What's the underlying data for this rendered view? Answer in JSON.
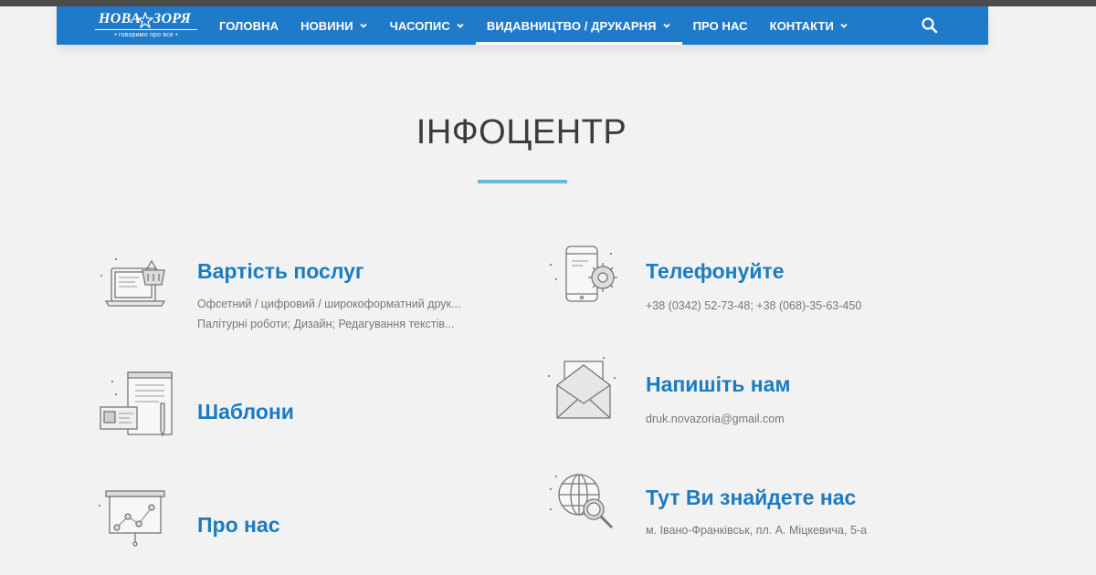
{
  "logo": {
    "word1": "НОВА",
    "word2": "ЗОРЯ",
    "slogan": "• говоримо про все •"
  },
  "nav": {
    "items": [
      {
        "label": "ГОЛОВНА",
        "has_dropdown": false
      },
      {
        "label": "НОВИНИ",
        "has_dropdown": true
      },
      {
        "label": "ЧАСОПИС",
        "has_dropdown": true
      },
      {
        "label": "ВИДАВНИЦТВО / ДРУКАРНЯ",
        "has_dropdown": true,
        "active": true
      },
      {
        "label": "ПРО НАС",
        "has_dropdown": false
      },
      {
        "label": "КОНТАКТИ",
        "has_dropdown": true
      }
    ],
    "search_icon": "search-icon"
  },
  "page": {
    "title": "ІНФОЦЕНТР"
  },
  "cards": {
    "services": {
      "title": "Вартість послуг",
      "line1": "Офсетний / цифровий / широкоформатний друк...",
      "line2": "Палітурні роботи; Дизайн; Редагування текстів...",
      "icon": "laptop-basket-icon"
    },
    "templates": {
      "title": "Шаблони",
      "icon": "document-pencil-icon"
    },
    "about": {
      "title": "Про нас",
      "icon": "presentation-board-icon"
    },
    "phone": {
      "title": "Телефонуйте",
      "line1": "+38 (0342) 52-73-48; +38 (068)-35-63-450",
      "icon": "phone-gear-icon"
    },
    "write": {
      "title": "Напишіть нам",
      "line1": "druk.novazoria@gmail.com",
      "icon": "envelope-icon"
    },
    "find": {
      "title": "Тут Ви знайдете нас",
      "line1": "м. Івано-Франківськ, пл. А. Міцкевича, 5-а",
      "icon": "globe-search-icon"
    }
  },
  "colors": {
    "nav_bg": "#1f7ac9",
    "accent": "#1b7bc2",
    "title_bar": "#6cb8dc",
    "page_bg": "#f2f2f2"
  }
}
